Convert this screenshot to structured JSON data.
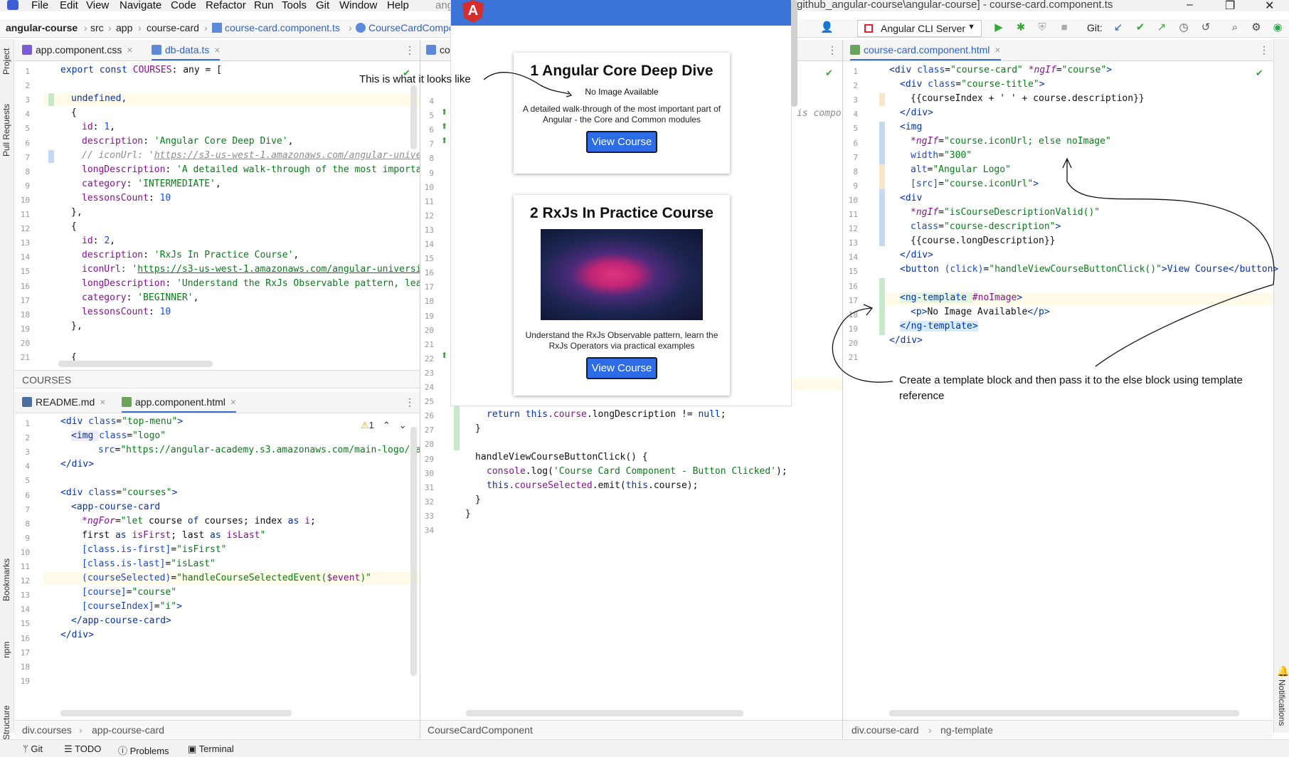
{
  "menu": {
    "items": [
      "File",
      "Edit",
      "View",
      "Navigate",
      "Code",
      "Refactor",
      "Run",
      "Tools",
      "Git",
      "Window",
      "Help"
    ],
    "title_fragment": "ang",
    "window_title": "github_angular-course\\angular-course] - course-card.component.ts"
  },
  "nav": {
    "breadcrumb": [
      "angular-course",
      "src",
      "app",
      "course-card",
      "course-card.component.ts",
      "CourseCardCompo"
    ],
    "run_config": "Angular CLI Server",
    "git_label": "Git:"
  },
  "left_strip": {
    "project": "Project",
    "pull_requests": "Pull Requests",
    "bookmarks": "Bookmarks",
    "npm": "npm",
    "structure": "Structure"
  },
  "right_strip": {
    "notifications": "Notifications"
  },
  "panes": {
    "top_left": {
      "tabs": [
        {
          "label": "app.component.css",
          "icon": "CSS"
        },
        {
          "label": "db-data.ts",
          "icon": "TS"
        }
      ],
      "footer": "COURSES",
      "lines": [
        "1",
        "2",
        "3",
        "4",
        "5",
        "6",
        "7",
        "8",
        "9",
        "10",
        "11",
        "12",
        "13",
        "14",
        "15",
        "16",
        "17",
        "18",
        "19",
        "20",
        "21"
      ],
      "code": {
        "l1a": "export const ",
        "l1b": "COURSES",
        "l1c": ": any = [",
        "l3": "undefined,",
        "l4": "{",
        "l5a": "id",
        "l5b": ": ",
        "l5c": "1",
        "l5d": ",",
        "l6a": "description",
        "l6b": ": ",
        "l6c": "'Angular Core Deep Dive'",
        "l6d": ",",
        "l7a": "// iconUrl: '",
        "l7b": "https://s3-us-west-1.amazonaws.com/angular-univers",
        "l8a": "longDescription",
        "l8b": ": ",
        "l8c": "'A detailed walk-through of the most importan",
        "l9a": "category",
        "l9b": ": ",
        "l9c": "'INTERMEDIATE'",
        "l9d": ",",
        "l10a": "lessonsCount",
        "l10b": ": ",
        "l10c": "10",
        "l11": "},",
        "l12": "{",
        "l13a": "id",
        "l13b": ": ",
        "l13c": "2",
        "l13d": ",",
        "l14a": "description",
        "l14b": ": ",
        "l14c": "'RxJs In Practice Course'",
        "l14d": ",",
        "l15a": "iconUrl",
        "l15b": ": '",
        "l15c": "https://s3-us-west-1.amazonaws.com/angular-university",
        "l16a": "longDescription",
        "l16b": ": ",
        "l16c": "'Understand the RxJs Observable pattern, learn",
        "l17a": "category",
        "l17b": ": ",
        "l17c": "'BEGINNER'",
        "l17d": ",",
        "l18a": "lessonsCount",
        "l18b": ": ",
        "l18c": "10",
        "l19": "},",
        "l21": "{"
      }
    },
    "bottom_left": {
      "tabs": [
        {
          "label": "README.md",
          "icon": "MD"
        },
        {
          "label": "app.component.html",
          "icon": "H"
        }
      ],
      "warning": "1",
      "breadcrumb": [
        "div.courses",
        "app-course-card"
      ],
      "lines": [
        "1",
        "2",
        "3",
        "4",
        "5",
        "6",
        "7",
        "8",
        "9",
        "10",
        "11",
        "12",
        "13",
        "14",
        "15",
        "16",
        "17",
        "18",
        "19"
      ],
      "code": {
        "l1a": "<div ",
        "l1b": "class",
        "l1c": "=",
        "l1d": "\"top-menu\"",
        "l1e": ">",
        "l2a": "<img ",
        "l2b": "class",
        "l2c": "=",
        "l2d": "\"logo\"",
        "l3a": "src",
        "l3b": "=",
        "l3c": "\"https://angular-academy.s3.amazonaws.com/main-logo/mai",
        "l4": "</div>",
        "l6a": "<div ",
        "l6b": "class",
        "l6c": "=",
        "l6d": "\"courses\"",
        "l6e": ">",
        "l7": "<app-course-card",
        "l8a": "*ngFor",
        "l8b": "=",
        "l8c": "\"let ",
        "l8d": "course",
        "l8e": " of ",
        "l8f": "courses",
        "l8g": "; index ",
        "l8h": "as ",
        "l8i": "i",
        "l8j": ";",
        "l9a": "first ",
        "l9b": "as ",
        "l9c": "isFirst",
        "l9d": "; last ",
        "l9e": "as ",
        "l9f": "isLast",
        "l9g": "\"",
        "l10a": "[class.is-first]",
        "l10b": "=",
        "l10c": "\"isFirst\"",
        "l11a": "[class.is-last]",
        "l11b": "=",
        "l11c": "\"isLast\"",
        "l12a": "(courseSelected)",
        "l12b": "=",
        "l12c": "\"handleCourseSelectedEvent(",
        "l12d": "$event",
        "l12e": ")\"",
        "l13a": "[course]",
        "l13b": "=",
        "l13c": "\"course\"",
        "l14a": "[courseIndex]",
        "l14b": "=",
        "l14c": "\"i\"",
        "l14d": ">",
        "l15": "</app-course-card>",
        "l16": "</div>"
      }
    },
    "middle": {
      "tab_label": "co",
      "breadcrumb": "CourseCardComponent",
      "lines": [
        "4",
        "5",
        "6",
        "7",
        "8",
        "9",
        "10",
        "11",
        "12",
        "13",
        "14",
        "15",
        "16",
        "17",
        "18",
        "19",
        "20",
        "21",
        "22",
        "23",
        "24",
        "25",
        "26",
        "27",
        "28",
        "29",
        "30",
        "31",
        "32",
        "33",
        "34"
      ],
      "fragment": "is compo",
      "code": {
        "l26a": "return this",
        "l26b": ".course",
        "l26c": ".longDescription != ",
        "l26d": "null",
        "l26e": ";",
        "l27": "}",
        "l29": "handleViewCourseButtonClick() {",
        "l30a": "console",
        "l30b": ".log(",
        "l30c": "'Course Card Component - Button Clicked'",
        "l30d": ");",
        "l31a": "this",
        "l31b": ".courseSelected",
        "l31c": ".emit(",
        "l31d": "this",
        "l31e": ".course);",
        "l32": "}",
        "l33": "}"
      }
    },
    "right": {
      "tab_label": "course-card.component.html",
      "breadcrumb": [
        "div.course-card",
        "ng-template"
      ],
      "lines": [
        "1",
        "2",
        "3",
        "4",
        "5",
        "6",
        "7",
        "8",
        "9",
        "10",
        "11",
        "12",
        "13",
        "14",
        "15",
        "16",
        "17",
        "18",
        "19",
        "20",
        "21"
      ],
      "code": {
        "l1a": "<div ",
        "l1b": "class",
        "l1c": "=",
        "l1d": "\"course-card\" ",
        "l1e": "*ngIf",
        "l1f": "=",
        "l1g": "\"course\"",
        "l1h": ">",
        "l2a": "<div ",
        "l2b": "class",
        "l2c": "=",
        "l2d": "\"course-title\"",
        "l2e": ">",
        "l3": "{{courseIndex + ' ' + course.description}}",
        "l4": "</div>",
        "l5": "<img",
        "l6a": "*ngIf",
        "l6b": "=",
        "l6c": "\"course.iconUrl; else noImage\"",
        "l7a": "width",
        "l7b": "=",
        "l7c": "\"300\"",
        "l8a": "alt",
        "l8b": "=",
        "l8c": "\"Angular Logo\"",
        "l9a": "[src]",
        "l9b": "=",
        "l9c": "\"course.iconUrl\"",
        "l9d": ">",
        "l10": "<div",
        "l11a": "*ngIf",
        "l11b": "=",
        "l11c": "\"isCourseDescriptionValid()\"",
        "l12a": "class",
        "l12b": "=",
        "l12c": "\"course-description\"",
        "l12d": ">",
        "l13": "{{course.longDescription}}",
        "l14": "</div>",
        "l15a": "<button ",
        "l15b": "(click)",
        "l15c": "=",
        "l15d": "\"handleViewCourseButtonClick()\"",
        "l15e": ">View Course</button>",
        "l17a": "<ng-template ",
        "l17b": "#noImage",
        "l17c": ">",
        "l18a": "<p>",
        "l18b": "No Image Available",
        "l18c": "</p>",
        "l19": "</ng-template>",
        "l20": "</div>"
      }
    }
  },
  "browser": {
    "cards": [
      {
        "title": "1 Angular Core Deep Dive",
        "no_image": "No Image Available",
        "description": "A detailed walk-through of the most important part of Angular - the Core and Common modules",
        "button": "View Course"
      },
      {
        "title": "2 RxJs In Practice Course",
        "description": "Understand the RxJs Observable pattern, learn the RxJs Operators via practical examples",
        "button": "View Course"
      }
    ]
  },
  "annotations": {
    "looks_like": "This is what it looks like",
    "template_note": "Create a template block and then pass it to the else block using template reference"
  },
  "bottom_tools": [
    "Git",
    "TODO",
    "Problems",
    "Terminal"
  ],
  "colors": {
    "accent": "#3b74d6",
    "angular_red": "#d62d2d",
    "button_blue": "#2e6be6",
    "run_green": "#3aa53a"
  }
}
